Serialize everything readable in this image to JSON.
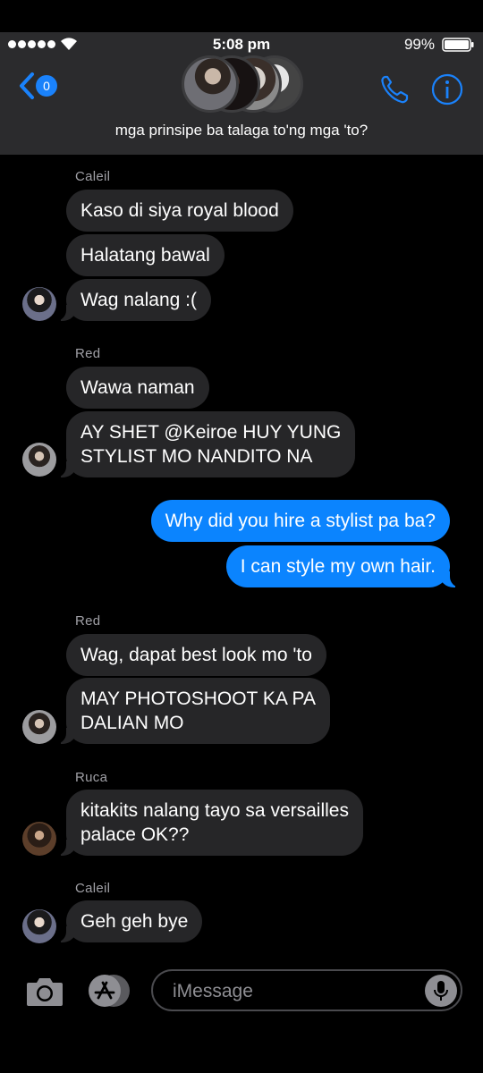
{
  "status_bar": {
    "time": "5:08 pm",
    "battery_percent": "99%"
  },
  "header": {
    "back_count": "0",
    "group_name": "mga prinsipe ba talaga to'ng mga 'to?",
    "accent_color": "#1a82fb",
    "icons": [
      "chevron-left-icon",
      "phone-icon",
      "info-icon"
    ]
  },
  "messages": [
    {
      "sender": "Caleil",
      "direction": "incoming",
      "text": "Kaso di siya royal blood"
    },
    {
      "sender": "Caleil",
      "direction": "incoming",
      "text": "Halatang bawal"
    },
    {
      "sender": "Caleil",
      "direction": "incoming",
      "text": "Wag nalang :("
    },
    {
      "sender": "Red",
      "direction": "incoming",
      "text": "Wawa naman"
    },
    {
      "sender": "Red",
      "direction": "incoming",
      "text": "AY SHET @Keiroe HUY YUNG STYLIST MO NANDITO NA",
      "lines": [
        "AY SHET @Keiroe HUY YUNG",
        "STYLIST MO NANDITO NA"
      ]
    },
    {
      "sender": "me",
      "direction": "outgoing",
      "text": "Why did you hire a stylist pa ba?"
    },
    {
      "sender": "me",
      "direction": "outgoing",
      "text": "I can style my own hair."
    },
    {
      "sender": "Red",
      "direction": "incoming",
      "text": "Wag, dapat best look mo 'to"
    },
    {
      "sender": "Red",
      "direction": "incoming",
      "text": "MAY PHOTOSHOOT KA PA DALIAN MO",
      "lines": [
        "MAY PHOTOSHOOT KA PA",
        "DALIAN MO"
      ]
    },
    {
      "sender": "Ruca",
      "direction": "incoming",
      "text": "kitakits nalang tayo sa versailles palace OK??",
      "lines": [
        "kitakits nalang tayo sa versailles",
        "palace OK??"
      ]
    },
    {
      "sender": "Caleil",
      "direction": "incoming",
      "text": "Geh geh bye"
    }
  ],
  "sender_labels": [
    "Caleil",
    "Red",
    "Red",
    "Ruca",
    "Caleil"
  ],
  "composer": {
    "placeholder": "iMessage",
    "icons": [
      "camera-icon",
      "app-store-icon",
      "microphone-icon"
    ]
  },
  "colors": {
    "incoming_bubble": "#262628",
    "outgoing_bubble": "#0b84fe",
    "header_bg": "#2b2b2d"
  }
}
